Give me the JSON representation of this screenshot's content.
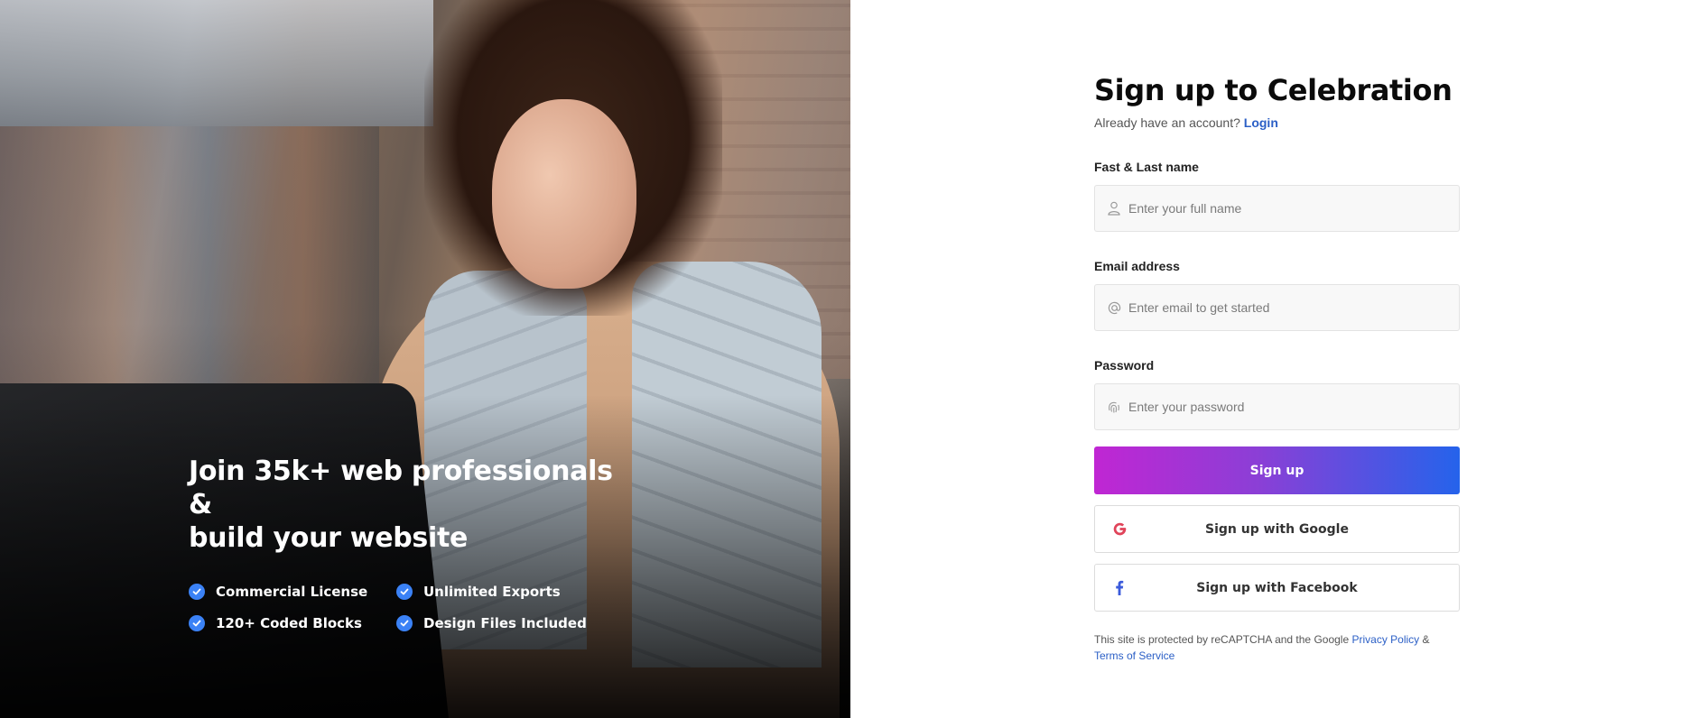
{
  "hero": {
    "title_line1": "Join 35k+ web professionals",
    "title_line2": "&",
    "title_line3": "build your website",
    "features": [
      "Commercial License",
      "Unlimited Exports",
      "120+ Coded Blocks",
      "Design Files Included"
    ],
    "check_color": "#3b82f6"
  },
  "form": {
    "title": "Sign up to Celebration",
    "subtitle": "Already have an account?",
    "login_link": "Login",
    "name": {
      "label": "Fast & Last name",
      "placeholder": "Enter your full name",
      "icon": "user-icon"
    },
    "email": {
      "label": "Email address",
      "placeholder": "Enter email to get started",
      "icon": "at-icon"
    },
    "password": {
      "label": "Password",
      "placeholder": "Enter your password",
      "icon": "fingerprint-icon"
    },
    "submit_label": "Sign up",
    "google_label": "Sign up with Google",
    "facebook_label": "Sign up with Facebook",
    "legal_prefix": "This site is protected by reCAPTCHA and the Google",
    "privacy_link": "Privacy Policy",
    "legal_amp": "&",
    "terms_link": "Terms of Service"
  },
  "colors": {
    "link": "#2b5fc6",
    "gradient_start": "#c026d3",
    "gradient_end": "#2563eb",
    "google_red": "#e0445a",
    "facebook_blue": "#3b5bdb"
  }
}
